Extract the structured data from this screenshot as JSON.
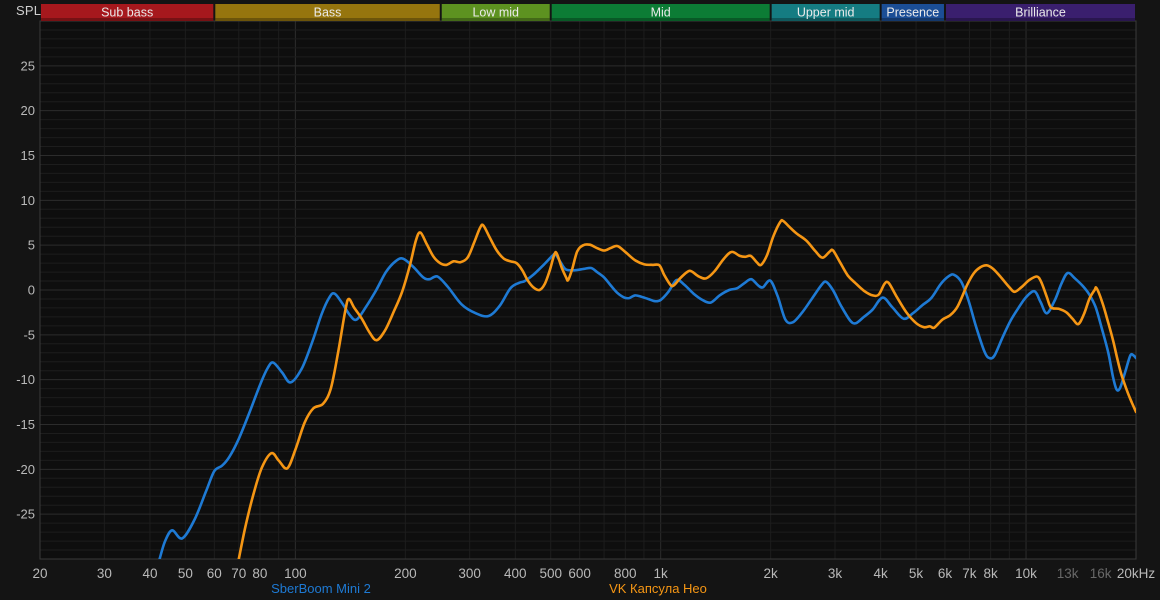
{
  "chart": {
    "spl_label": "SPL",
    "colors": {
      "background": "#141414",
      "plot_background": "#0e0e0e",
      "grid_minor": "#1d1d1d",
      "grid_major": "#2c2c2c",
      "axis_border": "#3a3a3a",
      "tick_label": "#b9b9b9",
      "tick_label_dim": "#686868",
      "band_label": "#ebebeb"
    }
  },
  "bands": [
    {
      "label": "Sub bass",
      "from_hz": 20,
      "to_hz": 60,
      "color": "#a6181d"
    },
    {
      "label": "Bass",
      "from_hz": 60,
      "to_hz": 250,
      "color": "#96750e"
    },
    {
      "label": "Low mid",
      "from_hz": 250,
      "to_hz": 500,
      "color": "#5d9220"
    },
    {
      "label": "Mid",
      "from_hz": 500,
      "to_hz": 2000,
      "color": "#0c7c35"
    },
    {
      "label": "Upper mid",
      "from_hz": 2000,
      "to_hz": 4000,
      "color": "#157c82"
    },
    {
      "label": "Presence",
      "from_hz": 4000,
      "to_hz": 6000,
      "color": "#1b4e96"
    },
    {
      "label": "Brilliance",
      "from_hz": 6000,
      "to_hz": 20000,
      "color": "#3a1f6e"
    }
  ],
  "x_ticks": [
    {
      "hz": 20,
      "label": "20",
      "dim": false
    },
    {
      "hz": 30,
      "label": "30",
      "dim": false
    },
    {
      "hz": 40,
      "label": "40",
      "dim": false
    },
    {
      "hz": 50,
      "label": "50",
      "dim": false
    },
    {
      "hz": 60,
      "label": "60",
      "dim": false
    },
    {
      "hz": 70,
      "label": "70",
      "dim": false
    },
    {
      "hz": 80,
      "label": "80",
      "dim": false
    },
    {
      "hz": 100,
      "label": "100",
      "dim": false
    },
    {
      "hz": 200,
      "label": "200",
      "dim": false
    },
    {
      "hz": 300,
      "label": "300",
      "dim": false
    },
    {
      "hz": 400,
      "label": "400",
      "dim": false
    },
    {
      "hz": 500,
      "label": "500",
      "dim": false
    },
    {
      "hz": 600,
      "label": "600",
      "dim": false
    },
    {
      "hz": 800,
      "label": "800",
      "dim": false
    },
    {
      "hz": 1000,
      "label": "1k",
      "dim": false
    },
    {
      "hz": 2000,
      "label": "2k",
      "dim": false
    },
    {
      "hz": 3000,
      "label": "3k",
      "dim": false
    },
    {
      "hz": 4000,
      "label": "4k",
      "dim": false
    },
    {
      "hz": 5000,
      "label": "5k",
      "dim": false
    },
    {
      "hz": 6000,
      "label": "6k",
      "dim": false
    },
    {
      "hz": 7000,
      "label": "7k",
      "dim": false
    },
    {
      "hz": 8000,
      "label": "8k",
      "dim": false
    },
    {
      "hz": 10000,
      "label": "10k",
      "dim": false
    },
    {
      "hz": 13000,
      "label": "13k",
      "dim": true
    },
    {
      "hz": 16000,
      "label": "16k",
      "dim": true
    },
    {
      "hz": 20000,
      "label": "20kHz",
      "dim": false
    }
  ],
  "y_ticks": [
    {
      "db": 25,
      "label": "25"
    },
    {
      "db": 20,
      "label": "20"
    },
    {
      "db": 15,
      "label": "15"
    },
    {
      "db": 10,
      "label": "10"
    },
    {
      "db": 5,
      "label": "5"
    },
    {
      "db": 0,
      "label": "0"
    },
    {
      "db": -5,
      "label": "-5"
    },
    {
      "db": -10,
      "label": "-10"
    },
    {
      "db": -15,
      "label": "-15"
    },
    {
      "db": -20,
      "label": "-20"
    },
    {
      "db": -25,
      "label": "-25"
    }
  ],
  "legend": [
    {
      "label": "SberBoom Mini 2",
      "color": "#1e7ad4",
      "center_x": 321
    },
    {
      "label": "VK Капсула Нео",
      "color": "#f59614",
      "center_x": 658
    }
  ],
  "chart_data": {
    "type": "line",
    "x_scale": "log",
    "xlim": [
      20,
      20000
    ],
    "ylim": [
      -30,
      30
    ],
    "x_unit": "Hz",
    "y_unit": "dB SPL (relative)",
    "grid": true,
    "series": [
      {
        "name": "SberBoom Mini 2",
        "color": "#1e7ad4",
        "points": [
          [
            42.5,
            -30
          ],
          [
            44,
            -28
          ],
          [
            46,
            -26.8
          ],
          [
            49,
            -27.7
          ],
          [
            53,
            -25.6
          ],
          [
            57,
            -22.4
          ],
          [
            60,
            -20.2
          ],
          [
            63,
            -19.6
          ],
          [
            66,
            -18.6
          ],
          [
            70,
            -16.6
          ],
          [
            75,
            -13.6
          ],
          [
            80,
            -10.6
          ],
          [
            84,
            -8.7
          ],
          [
            87,
            -8.1
          ],
          [
            92,
            -9.2
          ],
          [
            97,
            -10.3
          ],
          [
            104,
            -8.8
          ],
          [
            111,
            -5.9
          ],
          [
            118,
            -2.7
          ],
          [
            124,
            -0.8
          ],
          [
            128,
            -0.4
          ],
          [
            134,
            -1.4
          ],
          [
            141,
            -2.8
          ],
          [
            147,
            -3.3
          ],
          [
            156,
            -1.9
          ],
          [
            166,
            -0.1
          ],
          [
            177,
            2.0
          ],
          [
            188,
            3.2
          ],
          [
            197,
            3.5
          ],
          [
            210,
            2.6
          ],
          [
            224,
            1.4
          ],
          [
            233,
            1.2
          ],
          [
            245,
            1.5
          ],
          [
            262,
            0.3
          ],
          [
            285,
            -1.6
          ],
          [
            312,
            -2.6
          ],
          [
            338,
            -2.9
          ],
          [
            362,
            -1.8
          ],
          [
            388,
            0.2
          ],
          [
            410,
            0.8
          ],
          [
            425,
            1.0
          ],
          [
            448,
            1.7
          ],
          [
            478,
            2.8
          ],
          [
            505,
            3.8
          ],
          [
            515,
            4.0
          ],
          [
            532,
            3.1
          ],
          [
            550,
            2.3
          ],
          [
            580,
            2.2
          ],
          [
            615,
            2.35
          ],
          [
            645,
            2.45
          ],
          [
            670,
            2.0
          ],
          [
            700,
            1.4
          ],
          [
            730,
            0.5
          ],
          [
            760,
            -0.3
          ],
          [
            795,
            -0.85
          ],
          [
            820,
            -0.9
          ],
          [
            850,
            -0.6
          ],
          [
            885,
            -0.75
          ],
          [
            925,
            -1.0
          ],
          [
            965,
            -1.25
          ],
          [
            1000,
            -1.1
          ],
          [
            1050,
            -0.2
          ],
          [
            1105,
            1.1
          ],
          [
            1160,
            0.6
          ],
          [
            1230,
            -0.4
          ],
          [
            1300,
            -1.1
          ],
          [
            1370,
            -1.4
          ],
          [
            1450,
            -0.6
          ],
          [
            1540,
            0.0
          ],
          [
            1620,
            0.2
          ],
          [
            1700,
            0.8
          ],
          [
            1770,
            1.2
          ],
          [
            1850,
            0.5
          ],
          [
            1905,
            0.3
          ],
          [
            1995,
            1.05
          ],
          [
            2090,
            -0.7
          ],
          [
            2195,
            -3.3
          ],
          [
            2300,
            -3.6
          ],
          [
            2440,
            -2.5
          ],
          [
            2600,
            -0.9
          ],
          [
            2760,
            0.6
          ],
          [
            2840,
            0.9
          ],
          [
            2960,
            0.0
          ],
          [
            3120,
            -1.8
          ],
          [
            3300,
            -3.4
          ],
          [
            3420,
            -3.7
          ],
          [
            3600,
            -3.0
          ],
          [
            3800,
            -2.2
          ],
          [
            4050,
            -0.85
          ],
          [
            4300,
            -1.9
          ],
          [
            4620,
            -3.2
          ],
          [
            4900,
            -2.6
          ],
          [
            5200,
            -1.7
          ],
          [
            5500,
            -0.9
          ],
          [
            5850,
            0.7
          ],
          [
            6150,
            1.55
          ],
          [
            6350,
            1.7
          ],
          [
            6650,
            0.9
          ],
          [
            6950,
            -1.1
          ],
          [
            7300,
            -4.1
          ],
          [
            7700,
            -6.9
          ],
          [
            7950,
            -7.6
          ],
          [
            8200,
            -7.3
          ],
          [
            8600,
            -5.4
          ],
          [
            9050,
            -3.5
          ],
          [
            9500,
            -2.1
          ],
          [
            10000,
            -0.8
          ],
          [
            10550,
            -0.15
          ],
          [
            10950,
            -1.3
          ],
          [
            11400,
            -2.6
          ],
          [
            12000,
            -1.1
          ],
          [
            12500,
            0.7
          ],
          [
            13000,
            1.9
          ],
          [
            13600,
            1.3
          ],
          [
            14300,
            0.45
          ],
          [
            14900,
            -0.5
          ],
          [
            15500,
            -1.9
          ],
          [
            16100,
            -4.2
          ],
          [
            16800,
            -7.0
          ],
          [
            17300,
            -9.7
          ],
          [
            17700,
            -11.1
          ],
          [
            18100,
            -10.9
          ],
          [
            18700,
            -9.1
          ],
          [
            19300,
            -7.3
          ],
          [
            19700,
            -7.3
          ],
          [
            20000,
            -7.6
          ]
        ]
      },
      {
        "name": "VK Капсула Нео",
        "color": "#f59614",
        "points": [
          [
            70,
            -30
          ],
          [
            73,
            -26.4
          ],
          [
            77,
            -22.6
          ],
          [
            81,
            -19.8
          ],
          [
            86,
            -18.2
          ],
          [
            90,
            -19.0
          ],
          [
            95,
            -19.9
          ],
          [
            100,
            -17.8
          ],
          [
            106,
            -14.8
          ],
          [
            112,
            -13.2
          ],
          [
            119,
            -12.7
          ],
          [
            125,
            -11.0
          ],
          [
            131,
            -6.9
          ],
          [
            137,
            -2.3
          ],
          [
            140,
            -1.0
          ],
          [
            145,
            -2.0
          ],
          [
            152,
            -3.2
          ],
          [
            160,
            -4.8
          ],
          [
            167,
            -5.6
          ],
          [
            176,
            -4.5
          ],
          [
            186,
            -2.4
          ],
          [
            196,
            -0.2
          ],
          [
            206,
            2.8
          ],
          [
            214,
            5.6
          ],
          [
            220,
            6.4
          ],
          [
            229,
            5.1
          ],
          [
            239,
            3.7
          ],
          [
            249,
            3.0
          ],
          [
            259,
            2.8
          ],
          [
            271,
            3.2
          ],
          [
            283,
            3.1
          ],
          [
            296,
            3.6
          ],
          [
            308,
            5.2
          ],
          [
            320,
            6.9
          ],
          [
            327,
            7.2
          ],
          [
            341,
            5.8
          ],
          [
            356,
            4.4
          ],
          [
            372,
            3.5
          ],
          [
            388,
            3.2
          ],
          [
            403,
            3.0
          ],
          [
            418,
            2.2
          ],
          [
            432,
            1.1
          ],
          [
            448,
            0.3
          ],
          [
            466,
            0.0
          ],
          [
            482,
            0.7
          ],
          [
            497,
            2.2
          ],
          [
            511,
            3.9
          ],
          [
            519,
            4.1
          ],
          [
            536,
            2.5
          ],
          [
            551,
            1.4
          ],
          [
            558,
            1.1
          ],
          [
            572,
            2.3
          ],
          [
            591,
            4.3
          ],
          [
            614,
            5.0
          ],
          [
            640,
            5.05
          ],
          [
            668,
            4.7
          ],
          [
            700,
            4.4
          ],
          [
            731,
            4.7
          ],
          [
            762,
            4.9
          ],
          [
            802,
            4.2
          ],
          [
            852,
            3.3
          ],
          [
            902,
            2.85
          ],
          [
            952,
            2.8
          ],
          [
            992,
            2.75
          ],
          [
            1022,
            1.7
          ],
          [
            1062,
            0.6
          ],
          [
            1085,
            0.5
          ],
          [
            1130,
            1.3
          ],
          [
            1180,
            2.0
          ],
          [
            1212,
            2.1
          ],
          [
            1272,
            1.5
          ],
          [
            1332,
            1.3
          ],
          [
            1405,
            2.1
          ],
          [
            1490,
            3.5
          ],
          [
            1565,
            4.25
          ],
          [
            1645,
            3.8
          ],
          [
            1705,
            3.7
          ],
          [
            1765,
            3.8
          ],
          [
            1832,
            3.1
          ],
          [
            1882,
            2.8
          ],
          [
            1955,
            3.9
          ],
          [
            2035,
            6.0
          ],
          [
            2125,
            7.6
          ],
          [
            2165,
            7.7
          ],
          [
            2255,
            7.0
          ],
          [
            2355,
            6.3
          ],
          [
            2505,
            5.5
          ],
          [
            2655,
            4.3
          ],
          [
            2775,
            3.6
          ],
          [
            2905,
            4.3
          ],
          [
            2965,
            4.4
          ],
          [
            3105,
            3.0
          ],
          [
            3255,
            1.6
          ],
          [
            3405,
            0.8
          ],
          [
            3605,
            -0.1
          ],
          [
            3805,
            -0.6
          ],
          [
            3955,
            -0.5
          ],
          [
            4100,
            0.7
          ],
          [
            4205,
            0.8
          ],
          [
            4405,
            -0.6
          ],
          [
            4705,
            -2.5
          ],
          [
            5005,
            -3.7
          ],
          [
            5255,
            -4.15
          ],
          [
            5455,
            -4.05
          ],
          [
            5605,
            -4.2
          ],
          [
            5905,
            -3.3
          ],
          [
            6205,
            -2.8
          ],
          [
            6505,
            -1.8
          ],
          [
            6905,
            0.6
          ],
          [
            7205,
            1.9
          ],
          [
            7505,
            2.55
          ],
          [
            7805,
            2.75
          ],
          [
            8105,
            2.4
          ],
          [
            8505,
            1.5
          ],
          [
            9005,
            0.3
          ],
          [
            9305,
            -0.2
          ],
          [
            9705,
            0.3
          ],
          [
            10205,
            1.1
          ],
          [
            10705,
            1.5
          ],
          [
            11005,
            0.9
          ],
          [
            11405,
            -0.8
          ],
          [
            11705,
            -1.95
          ],
          [
            12305,
            -2.1
          ],
          [
            12905,
            -2.5
          ],
          [
            13405,
            -3.2
          ],
          [
            13905,
            -3.8
          ],
          [
            14405,
            -2.7
          ],
          [
            14905,
            -1.0
          ],
          [
            15405,
            0.0
          ],
          [
            15605,
            0.2
          ],
          [
            16205,
            -1.5
          ],
          [
            16805,
            -3.7
          ],
          [
            17305,
            -5.6
          ],
          [
            17805,
            -7.8
          ],
          [
            18305,
            -9.6
          ],
          [
            19005,
            -11.5
          ],
          [
            19505,
            -12.6
          ],
          [
            20000,
            -13.6
          ]
        ]
      }
    ]
  }
}
